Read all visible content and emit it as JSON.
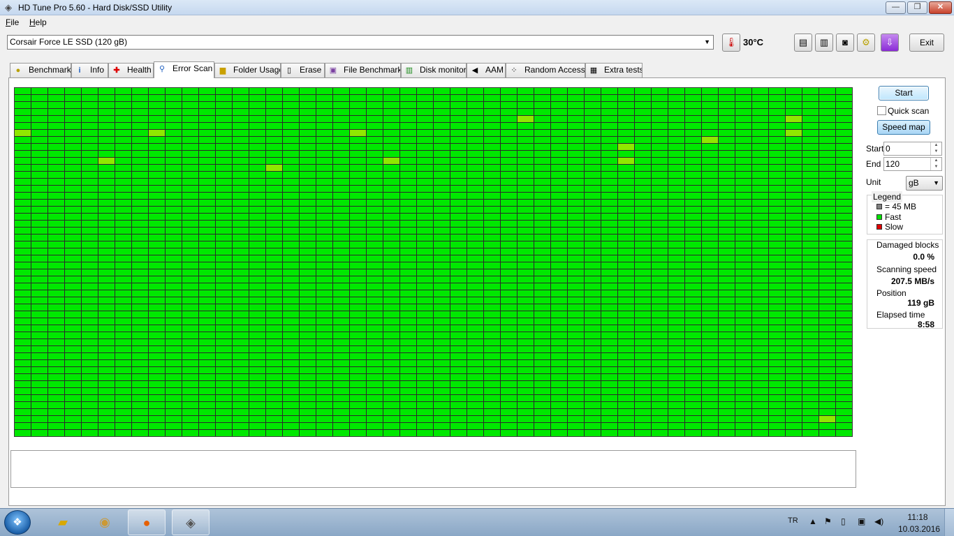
{
  "window": {
    "title": "HD Tune Pro 5.60 - Hard Disk/SSD Utility",
    "controls": {
      "minimize": "—",
      "maximize": "❐",
      "close": "✕"
    }
  },
  "menu": {
    "file": "File",
    "help": "Help"
  },
  "toolbar": {
    "drive": "Corsair Force LE SSD (120 gB)",
    "temperature": "30°C",
    "exit_label": "Exit",
    "icons": [
      "thermometer-icon",
      "copy-text-icon",
      "copy-info-icon",
      "camera-icon",
      "options-icon",
      "save-icon"
    ]
  },
  "tabs": [
    {
      "label": "Benchmark",
      "icon": "benchmark-icon"
    },
    {
      "label": "Info",
      "icon": "info-icon"
    },
    {
      "label": "Health",
      "icon": "health-icon"
    },
    {
      "label": "Error Scan",
      "icon": "magnifier-icon",
      "active": true
    },
    {
      "label": "Folder Usage",
      "icon": "folder-icon"
    },
    {
      "label": "Erase",
      "icon": "trash-icon"
    },
    {
      "label": "File Benchmark",
      "icon": "file-benchmark-icon"
    },
    {
      "label": "Disk monitor",
      "icon": "disk-monitor-icon"
    },
    {
      "label": "AAM",
      "icon": "speaker-icon"
    },
    {
      "label": "Random Access",
      "icon": "random-access-icon"
    },
    {
      "label": "Extra tests",
      "icon": "extra-tests-icon"
    }
  ],
  "controls": {
    "start_button": "Start",
    "quick_scan": {
      "label": "Quick scan",
      "checked": false
    },
    "speed_map_button": "Speed map",
    "start_label": "Start",
    "start_value": "0",
    "end_label": "End",
    "end_value": "120",
    "unit_label": "Unit",
    "unit_value": "gB"
  },
  "legend": {
    "title": "Legend",
    "items": [
      {
        "label": "= 45 MB",
        "color": "#808080"
      },
      {
        "label": "Fast",
        "color": "#00e000"
      },
      {
        "label": "Slow",
        "color": "#e00000"
      }
    ]
  },
  "stats": {
    "damaged_label": "Damaged blocks",
    "damaged_value": "0.0 %",
    "speed_label": "Scanning speed",
    "speed_value": "207.5 MB/s",
    "position_label": "Position",
    "position_value": "119 gB",
    "elapsed_label": "Elapsed time",
    "elapsed_value": "8:58"
  },
  "scan_map": {
    "columns": 50,
    "rows": 50,
    "block_color": "#00e800",
    "highlight_color": "#90e800"
  },
  "taskbar": {
    "apps": [
      "windows-explorer-icon",
      "chrome-icon",
      "firefox-icon",
      "hdtune-icon"
    ],
    "language": "TR",
    "time": "11:18",
    "date": "10.03.2016"
  }
}
